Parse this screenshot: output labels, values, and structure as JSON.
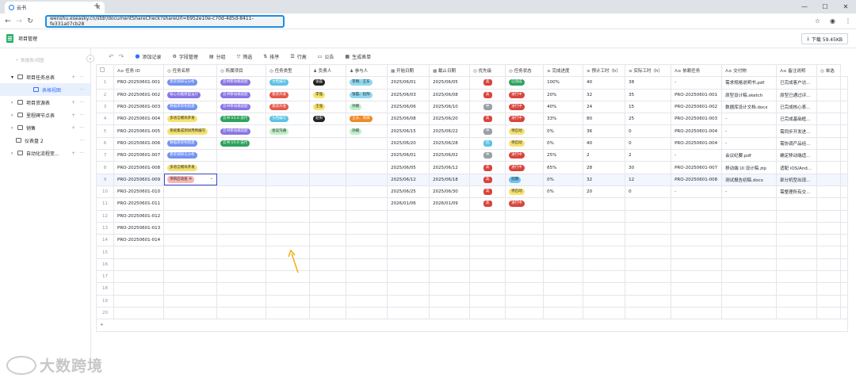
{
  "browser": {
    "tab_title": "云书",
    "url": "wenshu.eseasky.cn/stdr/documentShareCheck?shareUrl=b952e10e-c70d-4d5d-8411-fe331a07cb28"
  },
  "app": {
    "title": "项目管理",
    "download_label": "下载 59.45KB"
  },
  "sidebar": {
    "search_placeholder": "数据表/视图",
    "items": [
      {
        "label": "项目任务总表",
        "level": 0,
        "expanded": true
      },
      {
        "label": "表格视图",
        "level": 1,
        "active": true
      },
      {
        "label": "项目资源表",
        "level": 0
      },
      {
        "label": "里程碑节点表",
        "level": 0
      },
      {
        "label": "销售",
        "level": 0
      },
      {
        "label": "仪表盘 2",
        "level": -1
      },
      {
        "label": "自动化流程变...",
        "level": 0
      }
    ]
  },
  "toolbar": {
    "add_record": "添加记录",
    "field_mgmt": "字段管理",
    "group": "分组",
    "filter": "筛选",
    "sort": "排序",
    "row_height": "行高",
    "notice": "公告",
    "gen_form": "生成表单"
  },
  "colors": {
    "blue": "#6e8ff5",
    "purple": "#8a75e5",
    "red": "#d9443c",
    "green": "#2fa25c",
    "orange": "#f08a24",
    "black": "#222222",
    "teal": "#9ee3d9",
    "yellow": "#f7e26f",
    "pink": "#f9b5b5",
    "grey": "#d0d3d6"
  },
  "table": {
    "headers": [
      "任务 ID",
      "任务名称",
      "所属项目",
      "任务类型",
      "负责人",
      "参与人",
      "开始日期",
      "截止日期",
      "优先级",
      "任务状态",
      "完成进度",
      "预计工时（h）",
      "实际工时（h）",
      "依赖任务",
      "交付物",
      "备注说明",
      "单选"
    ],
    "rows": [
      {
        "n": "1",
        "id": "PRO-20250601-001",
        "name": {
          "t": "需求调研与分析",
          "c": "#7391f3"
        },
        "proj": {
          "t": "云书移动端适配",
          "c": "#8a75e5"
        },
        "type": {
          "t": "文档编写",
          "c": "#5cc2e6"
        },
        "owner": {
          "t": "张磊",
          "c": "#222222"
        },
        "part": {
          "t": "李明、王东",
          "c": "#8fd8ef"
        },
        "start": "2025/06/01",
        "end": "2025/06/05",
        "pri": {
          "t": "高",
          "c": "#d9443c"
        },
        "status": {
          "t": "已完成",
          "c": "#2fa25c"
        },
        "prog": "100%",
        "est": "40",
        "act": "38",
        "dep": "-",
        "deliv": "需求规格说明书.pdf",
        "note": "已完成客户访..."
      },
      {
        "n": "2",
        "id": "PRO-20250601-002",
        "name": {
          "t": "核心功能原型设计",
          "c": "#8a75e5"
        },
        "proj": {
          "t": "云书移动端适配",
          "c": "#8a75e5"
        },
        "type": {
          "t": "需求开发",
          "c": "#e4584a"
        },
        "owner": {
          "t": "李强",
          "c": "#f7e26f"
        },
        "part": {
          "t": "张磊、赵阳",
          "c": "#8fd8ef"
        },
        "start": "2025/06/03",
        "end": "2025/06/08",
        "pri": {
          "t": "高",
          "c": "#d9443c"
        },
        "status": {
          "t": "进行中",
          "c": "#d9443c"
        },
        "prog": "20%",
        "est": "32",
        "act": "35",
        "dep": "PRO-20250601-001",
        "deliv": "原型设计稿.sketch",
        "note": "原型已通过评..."
      },
      {
        "n": "3",
        "id": "PRO-20250601-003",
        "name": {
          "t": "数据库架构搭建",
          "c": "#7391f3"
        },
        "proj": {
          "t": "云书移动端适配",
          "c": "#8a75e5"
        },
        "type": {
          "t": "需求开发",
          "c": "#e4584a"
        },
        "owner": {
          "t": "王强",
          "c": "#f7e26f"
        },
        "part": {
          "t": "孙楠",
          "c": "#bff0c8"
        },
        "start": "2025/06/06",
        "end": "2025/06/10",
        "pri": {
          "t": "中",
          "c": "#9aa0a6"
        },
        "status": {
          "t": "进行中",
          "c": "#d9443c"
        },
        "prog": "40%",
        "est": "24",
        "act": "15",
        "dep": "PRO-20250601-002",
        "deliv": "数据库设计文档.docx",
        "note": "已完成核心表..."
      },
      {
        "n": "4",
        "id": "PRO-20250601-004",
        "name": {
          "t": "多语言模块开发",
          "c": "#f7e26f"
        },
        "proj": {
          "t": "云书 V3.0 迭代",
          "c": "#2fa25c"
        },
        "type": {
          "t": "文档编写",
          "c": "#5cc2e6"
        },
        "owner": {
          "t": "赵阳",
          "c": "#222222"
        },
        "part": {
          "t": "王东、周锋",
          "c": "#f08a24"
        },
        "start": "2025/06/08",
        "end": "2025/06/20",
        "pri": {
          "t": "高",
          "c": "#d9443c"
        },
        "status": {
          "t": "进行中",
          "c": "#d9443c"
        },
        "prog": "33%",
        "est": "80",
        "act": "25",
        "dep": "PRO-20250601-003",
        "deliv": "-",
        "note": "已完成基础框..."
      },
      {
        "n": "5",
        "id": "PRO-20250601-005",
        "name": {
          "t": "系统集成测试用例编写",
          "c": "#f7e26f"
        },
        "proj": {
          "t": "云书移动端适配",
          "c": "#8a75e5"
        },
        "type": {
          "t": "会议沟通",
          "c": "#bff0c8"
        },
        "owner": {
          "t": "",
          "c": ""
        },
        "part": {
          "t": "孙楠",
          "c": "#bff0c8"
        },
        "start": "2025/06/15",
        "end": "2025/06/22",
        "pri": {
          "t": "中",
          "c": "#9aa0a6"
        },
        "status": {
          "t": "待启动",
          "c": "#f7e26f"
        },
        "prog": "0%",
        "est": "36",
        "act": "0",
        "dep": "PRO-20250601-004",
        "deliv": "-",
        "note": "需同步开发进..."
      },
      {
        "n": "6",
        "id": "PRO-20250601-006",
        "name": {
          "t": "数据库架构搭建",
          "c": "#7391f3"
        },
        "proj": {
          "t": "云书 V3.0 迭代",
          "c": "#2fa25c"
        },
        "type": {
          "t": "",
          "c": ""
        },
        "owner": {
          "t": "",
          "c": ""
        },
        "part": {
          "t": "",
          "c": ""
        },
        "start": "2025/06/20",
        "end": "2025/06/28",
        "pri": {
          "t": "低",
          "c": "#5cc2e6"
        },
        "status": {
          "t": "待启动",
          "c": "#f7e26f"
        },
        "prog": "0%",
        "est": "40",
        "act": "0",
        "dep": "PRO-20250601-004",
        "deliv": "-",
        "note": "需协调产品经..."
      },
      {
        "n": "7",
        "id": "PRO-20250601-007",
        "name": {
          "t": "需求调研与分析",
          "c": "#7391f3"
        },
        "proj": {
          "t": "",
          "c": ""
        },
        "type": {
          "t": "",
          "c": ""
        },
        "owner": {
          "t": "",
          "c": ""
        },
        "part": {
          "t": "",
          "c": ""
        },
        "start": "2025/06/01",
        "end": "2025/06/02",
        "pri": {
          "t": "中",
          "c": "#9aa0a6"
        },
        "status": {
          "t": "进行中",
          "c": "#d9443c"
        },
        "prog": "25%",
        "est": "2",
        "act": "2",
        "dep": "-",
        "deliv": "会议纪要.pdf",
        "note": "确定移动端适..."
      },
      {
        "n": "8",
        "id": "PRO-20250601-008",
        "name": {
          "t": "多语言模块开发",
          "c": "#f7e26f"
        },
        "proj": {
          "t": "",
          "c": ""
        },
        "type": {
          "t": "",
          "c": ""
        },
        "owner": {
          "t": "",
          "c": ""
        },
        "part": {
          "t": "",
          "c": ""
        },
        "start": "2025/06/05",
        "end": "2025/06/12",
        "pri": {
          "t": "高",
          "c": "#d9443c"
        },
        "status": {
          "t": "进行中",
          "c": "#d9443c"
        },
        "prog": "65%",
        "est": "28",
        "act": "30",
        "dep": "PRO-20250601-007",
        "deliv": "移动端 UI 设计稿.zip",
        "note": "适配 iOS/And..."
      },
      {
        "n": "9",
        "id": "PRO-20250601-009",
        "name": {
          "t": "项目启动会",
          "c": "#f9b5b5"
        },
        "proj": {
          "t": "",
          "c": ""
        },
        "type": {
          "t": "",
          "c": ""
        },
        "owner": {
          "t": "",
          "c": ""
        },
        "part": {
          "t": "",
          "c": ""
        },
        "start": "2025/06/12",
        "end": "2025/06/18",
        "pri": {
          "t": "高",
          "c": "#d9443c"
        },
        "status": {
          "t": "延期",
          "c": "#6fc3f0"
        },
        "prog": "0%",
        "est": "32",
        "act": "12",
        "dep": "PRO-20250601-008",
        "deliv": "测试报告初稿.docx",
        "note": "部分机型出现..."
      },
      {
        "n": "10",
        "id": "PRO-20250601-010",
        "name": {
          "t": "",
          "c": ""
        },
        "proj": {
          "t": "",
          "c": ""
        },
        "type": {
          "t": "",
          "c": ""
        },
        "owner": {
          "t": "",
          "c": ""
        },
        "part": {
          "t": "",
          "c": ""
        },
        "start": "2025/06/25",
        "end": "2025/06/30",
        "pri": {
          "t": "高",
          "c": "#d9443c"
        },
        "status": {
          "t": "待启动",
          "c": "#f7e26f"
        },
        "prog": "0%",
        "est": "20",
        "act": "0",
        "dep": "-",
        "deliv": "-",
        "note": "需整理所有交..."
      },
      {
        "n": "11",
        "id": "PRO-20250601-011",
        "name": {
          "t": "",
          "c": ""
        },
        "proj": {
          "t": "",
          "c": ""
        },
        "type": {
          "t": "",
          "c": ""
        },
        "owner": {
          "t": "",
          "c": ""
        },
        "part": {
          "t": "",
          "c": ""
        },
        "start": "2026/01/06",
        "end": "2026/01/09",
        "pri": {
          "t": "高",
          "c": "#d9443c"
        },
        "status": {
          "t": "进行中",
          "c": "#d9443c"
        },
        "prog": "",
        "est": "",
        "act": "",
        "dep": "",
        "deliv": "",
        "note": ""
      },
      {
        "n": "12",
        "id": "PRO-20250601-012"
      },
      {
        "n": "13",
        "id": "PRO-20250601-013"
      },
      {
        "n": "14",
        "id": "PRO-20250601-014"
      },
      {
        "n": "15",
        "id": ""
      },
      {
        "n": "16",
        "id": ""
      },
      {
        "n": "17",
        "id": ""
      },
      {
        "n": "18",
        "id": ""
      },
      {
        "n": "19",
        "id": ""
      },
      {
        "n": "20",
        "id": ""
      }
    ],
    "add_row": "+"
  },
  "watermark": "大数跨境"
}
